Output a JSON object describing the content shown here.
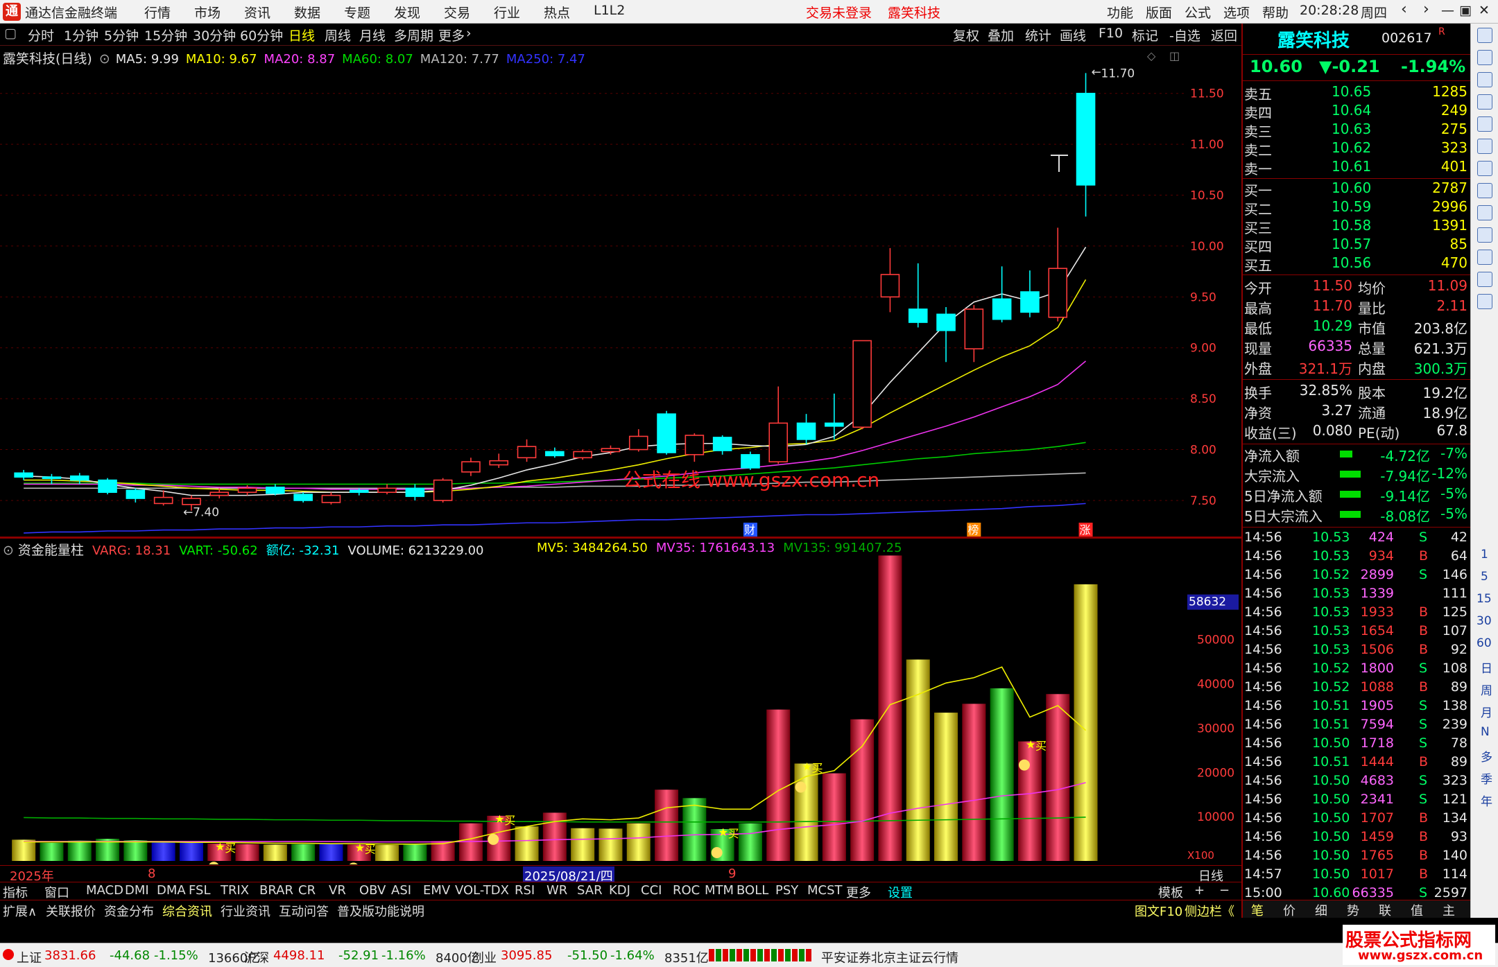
{
  "titlebar": {
    "app_name": "通达信金融终端",
    "menus": [
      "行情",
      "市场",
      "资讯",
      "数据",
      "专题",
      "发现",
      "交易",
      "行业",
      "热点",
      "L1L2"
    ],
    "trade_status": "交易未登录",
    "stock_name": "露笑科技",
    "right_menus": [
      "功能",
      "版面",
      "公式",
      "选项",
      "帮助"
    ],
    "time": "20:28:28",
    "weekday": "周四"
  },
  "periodbar": {
    "items": [
      "分时",
      "1分钟",
      "5分钟",
      "15分钟",
      "30分钟",
      "60分钟",
      "日线",
      "周线",
      "月线",
      "多周期",
      "更多"
    ],
    "selected": "日线",
    "right_items": [
      "复权",
      "叠加",
      "统计",
      "画线",
      "F10",
      "标记",
      "-自选",
      "返回"
    ]
  },
  "main_chart": {
    "legend_name": "露笑科技(日线)",
    "ma": [
      {
        "label": "MA5: 9.99",
        "color": "#e8e8e8"
      },
      {
        "label": "MA10: 9.67",
        "color": "#ffff00"
      },
      {
        "label": "MA20: 8.87",
        "color": "#ff44ff"
      },
      {
        "label": "MA60: 8.07",
        "color": "#00dd00"
      },
      {
        "label": "MA120: 7.77",
        "color": "#bbbbbb"
      },
      {
        "label": "MA250: 7.47",
        "color": "#3333ff"
      }
    ],
    "price_ticks": [
      "11.50",
      "11.00",
      "10.50",
      "10.00",
      "9.50",
      "9.00",
      "8.50",
      "8.00",
      "7.50"
    ],
    "high_label": "11.70",
    "low_label": "7.40",
    "watermark": "公式在线 www.gszx.com.cn",
    "event_markers": [
      "财",
      "榜",
      "涨"
    ]
  },
  "chart_data": {
    "type": "candlestick",
    "y_range": [
      7.2,
      11.9
    ],
    "candles": [
      {
        "o": 7.77,
        "c": 7.73,
        "h": 7.8,
        "l": 7.7
      },
      {
        "o": 7.73,
        "c": 7.72,
        "h": 7.76,
        "l": 7.66
      },
      {
        "o": 7.74,
        "c": 7.7,
        "h": 7.77,
        "l": 7.66
      },
      {
        "o": 7.7,
        "c": 7.58,
        "h": 7.72,
        "l": 7.56
      },
      {
        "o": 7.6,
        "c": 7.52,
        "h": 7.62,
        "l": 7.48
      },
      {
        "o": 7.47,
        "c": 7.53,
        "h": 7.6,
        "l": 7.45
      },
      {
        "o": 7.46,
        "c": 7.52,
        "h": 7.55,
        "l": 7.4
      },
      {
        "o": 7.55,
        "c": 7.58,
        "h": 7.62,
        "l": 7.52
      },
      {
        "o": 7.58,
        "c": 7.62,
        "h": 7.65,
        "l": 7.55
      },
      {
        "o": 7.63,
        "c": 7.57,
        "h": 7.66,
        "l": 7.55
      },
      {
        "o": 7.56,
        "c": 7.5,
        "h": 7.58,
        "l": 7.48
      },
      {
        "o": 7.48,
        "c": 7.55,
        "h": 7.58,
        "l": 7.46
      },
      {
        "o": 7.6,
        "c": 7.58,
        "h": 7.62,
        "l": 7.55
      },
      {
        "o": 7.58,
        "c": 7.62,
        "h": 7.66,
        "l": 7.56
      },
      {
        "o": 7.62,
        "c": 7.54,
        "h": 7.66,
        "l": 7.5
      },
      {
        "o": 7.5,
        "c": 7.7,
        "h": 7.72,
        "l": 7.48
      },
      {
        "o": 7.78,
        "c": 7.88,
        "h": 7.92,
        "l": 7.74
      },
      {
        "o": 7.85,
        "c": 7.89,
        "h": 7.96,
        "l": 7.82
      },
      {
        "o": 7.92,
        "c": 8.03,
        "h": 8.1,
        "l": 7.88
      },
      {
        "o": 7.98,
        "c": 7.94,
        "h": 8.02,
        "l": 7.92
      },
      {
        "o": 7.92,
        "c": 7.98,
        "h": 8.0,
        "l": 7.9
      },
      {
        "o": 7.98,
        "c": 8.01,
        "h": 8.04,
        "l": 7.95
      },
      {
        "o": 8.0,
        "c": 8.13,
        "h": 8.2,
        "l": 7.98
      },
      {
        "o": 8.35,
        "c": 7.97,
        "h": 8.38,
        "l": 7.95
      },
      {
        "o": 7.95,
        "c": 8.14,
        "h": 8.16,
        "l": 7.88
      },
      {
        "o": 8.12,
        "c": 7.99,
        "h": 8.14,
        "l": 7.95
      },
      {
        "o": 7.95,
        "c": 7.82,
        "h": 7.98,
        "l": 7.8
      },
      {
        "o": 7.88,
        "c": 8.26,
        "h": 8.62,
        "l": 7.86
      },
      {
        "o": 8.26,
        "c": 8.1,
        "h": 8.35,
        "l": 8.05
      },
      {
        "o": 8.26,
        "c": 8.23,
        "h": 8.55,
        "l": 8.1
      },
      {
        "o": 8.22,
        "c": 9.07,
        "h": 9.07,
        "l": 8.2
      },
      {
        "o": 9.5,
        "c": 9.72,
        "h": 9.98,
        "l": 9.35
      },
      {
        "o": 9.38,
        "c": 9.25,
        "h": 9.83,
        "l": 9.2
      },
      {
        "o": 9.33,
        "c": 9.17,
        "h": 9.4,
        "l": 8.86
      },
      {
        "o": 8.99,
        "c": 9.38,
        "h": 9.42,
        "l": 8.86
      },
      {
        "o": 9.48,
        "c": 9.28,
        "h": 9.8,
        "l": 9.25
      },
      {
        "o": 9.55,
        "c": 9.35,
        "h": 9.76,
        "l": 9.3
      },
      {
        "o": 9.3,
        "c": 9.78,
        "h": 10.18,
        "l": 9.26
      },
      {
        "o": 11.5,
        "c": 10.6,
        "h": 11.7,
        "l": 10.29
      }
    ],
    "ma5": [
      7.74,
      7.73,
      7.71,
      7.66,
      7.62,
      7.59,
      7.55,
      7.55,
      7.55,
      7.56,
      7.58,
      7.58,
      7.58,
      7.58,
      7.58,
      7.6,
      7.65,
      7.72,
      7.8,
      7.86,
      7.93,
      7.97,
      8.03,
      8.05,
      8.06,
      8.06,
      8.04,
      8.03,
      8.05,
      8.13,
      8.34,
      8.66,
      8.95,
      9.24,
      9.45,
      9.53,
      9.46,
      9.55,
      9.99
    ],
    "ma10": [
      7.7,
      7.7,
      7.69,
      7.68,
      7.66,
      7.64,
      7.62,
      7.61,
      7.6,
      7.6,
      7.59,
      7.58,
      7.58,
      7.58,
      7.58,
      7.59,
      7.61,
      7.64,
      7.69,
      7.72,
      7.76,
      7.8,
      7.85,
      7.91,
      7.96,
      8.0,
      8.02,
      8.05,
      8.06,
      8.09,
      8.21,
      8.36,
      8.5,
      8.64,
      8.78,
      8.91,
      9.02,
      9.2,
      9.67
    ],
    "ma20": [
      7.66,
      7.66,
      7.66,
      7.66,
      7.65,
      7.65,
      7.64,
      7.63,
      7.63,
      7.62,
      7.62,
      7.61,
      7.61,
      7.61,
      7.61,
      7.61,
      7.62,
      7.63,
      7.64,
      7.66,
      7.68,
      7.7,
      7.72,
      7.74,
      7.77,
      7.8,
      7.82,
      7.85,
      7.88,
      7.92,
      7.99,
      8.07,
      8.15,
      8.23,
      8.32,
      8.42,
      8.52,
      8.64,
      8.87
    ],
    "ma60": [
      7.67,
      7.67,
      7.67,
      7.67,
      7.67,
      7.66,
      7.66,
      7.66,
      7.66,
      7.66,
      7.66,
      7.66,
      7.66,
      7.66,
      7.66,
      7.66,
      7.67,
      7.67,
      7.68,
      7.68,
      7.69,
      7.7,
      7.71,
      7.72,
      7.73,
      7.74,
      7.76,
      7.78,
      7.8,
      7.82,
      7.85,
      7.88,
      7.91,
      7.93,
      7.96,
      7.98,
      8.0,
      8.03,
      8.07
    ],
    "ma120": [
      7.62,
      7.62,
      7.62,
      7.62,
      7.62,
      7.62,
      7.62,
      7.62,
      7.62,
      7.62,
      7.62,
      7.62,
      7.62,
      7.62,
      7.62,
      7.62,
      7.62,
      7.63,
      7.63,
      7.63,
      7.64,
      7.64,
      7.64,
      7.65,
      7.65,
      7.66,
      7.66,
      7.67,
      7.68,
      7.68,
      7.69,
      7.7,
      7.71,
      7.72,
      7.73,
      7.74,
      7.75,
      7.76,
      7.77
    ],
    "ma250": [
      7.18,
      7.19,
      7.19,
      7.2,
      7.2,
      7.21,
      7.21,
      7.22,
      7.22,
      7.23,
      7.23,
      7.24,
      7.24,
      7.25,
      7.25,
      7.26,
      7.26,
      7.27,
      7.28,
      7.28,
      7.29,
      7.3,
      7.31,
      7.31,
      7.32,
      7.33,
      7.34,
      7.35,
      7.36,
      7.36,
      7.37,
      7.38,
      7.39,
      7.4,
      7.41,
      7.42,
      7.44,
      7.45,
      7.47
    ]
  },
  "indicator": {
    "name": "资金能量柱",
    "fields": [
      {
        "label": "VARG: 18.31",
        "color": "#ff4444"
      },
      {
        "label": "VART: -50.62",
        "color": "#00ee00"
      },
      {
        "label": "额亿: -32.31",
        "color": "#00ffff"
      },
      {
        "label": "VOLUME: 6213229.00",
        "color": "#e8e8e8"
      }
    ],
    "mv_fields": [
      {
        "label": "MV5: 3484264.50",
        "color": "#ffff00"
      },
      {
        "label": "MV35: 1761643.13",
        "color": "#ff44ff"
      },
      {
        "label": "MV135: 991407.25",
        "color": "#00aa00"
      }
    ],
    "ticks": [
      "50000",
      "40000",
      "30000",
      "20000",
      "10000"
    ],
    "highlight_tick": "58632",
    "scale_label": "X100",
    "buy_label": "买",
    "bars": [
      4800,
      4100,
      4600,
      5000,
      4700,
      4300,
      4200,
      3900,
      3800,
      3700,
      3800,
      3900,
      3700,
      3600,
      3800,
      4500,
      8500,
      10200,
      7800,
      10900,
      7400,
      7300,
      8500,
      16100,
      14200,
      7200,
      8500,
      34200,
      22000,
      19800,
      32000,
      69000,
      45500,
      33500,
      35500,
      39000,
      27000,
      37700,
      62500
    ],
    "colors": [
      "y",
      "g",
      "g",
      "g",
      "g",
      "b",
      "b",
      "r",
      "r",
      "y",
      "g",
      "b",
      "r",
      "y",
      "g",
      "r",
      "r",
      "r",
      "y",
      "r",
      "y",
      "y",
      "y",
      "r",
      "g",
      "g",
      "g",
      "r",
      "y",
      "r",
      "r",
      "r",
      "y",
      "y",
      "r",
      "g",
      "r",
      "r",
      "y"
    ],
    "mv5": [
      4300,
      4300,
      4300,
      4300,
      4300,
      4300,
      4200,
      4200,
      4100,
      4000,
      4000,
      3900,
      3900,
      3800,
      3800,
      3900,
      5000,
      6500,
      7800,
      8900,
      9500,
      9300,
      9700,
      12000,
      12600,
      11700,
      11700,
      15900,
      19100,
      20400,
      25900,
      35300,
      37600,
      40200,
      41400,
      43800,
      32500,
      35100,
      29500,
      34000
    ],
    "mv35": [
      4400,
      4400,
      4400,
      4400,
      4400,
      4400,
      4400,
      4400,
      4400,
      4400,
      4400,
      4400,
      4300,
      4300,
      4300,
      4300,
      4400,
      4500,
      4600,
      4800,
      4900,
      5000,
      5200,
      5600,
      5900,
      6000,
      6200,
      7100,
      7700,
      8200,
      9000,
      10800,
      11900,
      12800,
      13700,
      14700,
      15200,
      16100,
      17700
    ],
    "mv135": [
      9800,
      9700,
      9700,
      9600,
      9600,
      9500,
      9500,
      9400,
      9400,
      9300,
      9300,
      9200,
      9200,
      9100,
      9100,
      9000,
      9000,
      8900,
      8900,
      8900,
      8800,
      8800,
      8800,
      8800,
      8800,
      8800,
      8800,
      8800,
      8900,
      8900,
      9000,
      9100,
      9200,
      9300,
      9400,
      9500,
      9600,
      9700,
      9900
    ],
    "buy_points": [
      7,
      12,
      17,
      25,
      28,
      36
    ]
  },
  "date_axis": {
    "labels": [
      "2025年",
      "8",
      "2025/08/21/四",
      "9"
    ],
    "mode": "日线"
  },
  "tabs_row1": [
    "指标",
    "窗口",
    "MACD",
    "DMI",
    "DMA",
    "FSL",
    "TRIX",
    "BRAR",
    "CR",
    "VR",
    "OBV",
    "ASI",
    "EMV",
    "VOL-TDX",
    "RSI",
    "WR",
    "SAR",
    "KDJ",
    "CCI",
    "ROC",
    "MTM",
    "BOLL",
    "PSY",
    "MCST",
    "更多",
    "设置"
  ],
  "tabs_row1_right": "模板",
  "tabs_row2": [
    "扩展∧",
    "关联报价",
    "资金分布",
    "综合资讯",
    "行业资讯",
    "互动问答",
    "普及版功能说明"
  ],
  "tabs_row2_right": [
    "图文F10",
    "侧边栏《"
  ],
  "side": {
    "name": "露笑科技",
    "code": "002617",
    "flag": "R",
    "price": "10.60",
    "change": "▼-0.21",
    "pct": "-1.94%",
    "asks": [
      {
        "label": "卖五",
        "price": "10.65",
        "vol": "1285"
      },
      {
        "label": "卖四",
        "price": "10.64",
        "vol": "249"
      },
      {
        "label": "卖三",
        "price": "10.63",
        "vol": "275"
      },
      {
        "label": "卖二",
        "price": "10.62",
        "vol": "323"
      },
      {
        "label": "卖一",
        "price": "10.61",
        "vol": "401"
      }
    ],
    "bids": [
      {
        "label": "买一",
        "price": "10.60",
        "vol": "2787"
      },
      {
        "label": "买二",
        "price": "10.59",
        "vol": "2996"
      },
      {
        "label": "买三",
        "price": "10.58",
        "vol": "1391"
      },
      {
        "label": "买四",
        "price": "10.57",
        "vol": "85"
      },
      {
        "label": "买五",
        "price": "10.56",
        "vol": "470"
      }
    ],
    "stats": [
      {
        "l1": "今开",
        "v1": "11.50",
        "c1": "r",
        "l2": "均价",
        "v2": "11.09",
        "c2": "r"
      },
      {
        "l1": "最高",
        "v1": "11.70",
        "c1": "r",
        "l2": "量比",
        "v2": "2.11",
        "c2": "r"
      },
      {
        "l1": "最低",
        "v1": "10.29",
        "c1": "g",
        "l2": "市值",
        "v2": "203.8亿",
        "c2": "w"
      },
      {
        "l1": "现量",
        "v1": "66335",
        "c1": "m",
        "l2": "总量",
        "v2": "621.3万",
        "c2": "w"
      },
      {
        "l1": "外盘",
        "v1": "321.1万",
        "c1": "r",
        "l2": "内盘",
        "v2": "300.3万",
        "c2": "g"
      }
    ],
    "stats2": [
      {
        "l1": "换手",
        "v1": "32.85%",
        "l2": "股本",
        "v2": "19.2亿"
      },
      {
        "l1": "净资",
        "v1": "3.27",
        "l2": "流通",
        "v2": "18.9亿"
      },
      {
        "l1": "收益(三)",
        "v1": "0.080",
        "l2": "PE(动)",
        "v2": "67.8"
      }
    ],
    "flows": [
      {
        "label": "净流入额",
        "value": "-4.72亿",
        "pct": "-7%"
      },
      {
        "label": "大宗流入",
        "value": "-7.94亿",
        "pct": "-12%"
      },
      {
        "label": "5日净流入额",
        "value": "-9.14亿",
        "pct": "-5%"
      },
      {
        "label": "5日大宗流入",
        "value": "-8.08亿",
        "pct": "-5%"
      }
    ],
    "ticks": [
      {
        "t": "14:56",
        "p": "10.53",
        "v": "424",
        "s": "S",
        "n": "42"
      },
      {
        "t": "14:56",
        "p": "10.53",
        "v": "934",
        "s": "B",
        "n": "64"
      },
      {
        "t": "14:56",
        "p": "10.52",
        "v": "2899",
        "s": "S",
        "n": "146"
      },
      {
        "t": "14:56",
        "p": "10.53",
        "v": "1339",
        "s": "",
        "n": "111"
      },
      {
        "t": "14:56",
        "p": "10.53",
        "v": "1933",
        "s": "B",
        "n": "125"
      },
      {
        "t": "14:56",
        "p": "10.53",
        "v": "1654",
        "s": "B",
        "n": "107"
      },
      {
        "t": "14:56",
        "p": "10.53",
        "v": "1506",
        "s": "B",
        "n": "92"
      },
      {
        "t": "14:56",
        "p": "10.52",
        "v": "1800",
        "s": "S",
        "n": "108"
      },
      {
        "t": "14:56",
        "p": "10.52",
        "v": "1088",
        "s": "B",
        "n": "89"
      },
      {
        "t": "14:56",
        "p": "10.51",
        "v": "1905",
        "s": "S",
        "n": "138"
      },
      {
        "t": "14:56",
        "p": "10.51",
        "v": "7594",
        "s": "S",
        "n": "239"
      },
      {
        "t": "14:56",
        "p": "10.50",
        "v": "1718",
        "s": "S",
        "n": "78"
      },
      {
        "t": "14:56",
        "p": "10.51",
        "v": "1444",
        "s": "B",
        "n": "89"
      },
      {
        "t": "14:56",
        "p": "10.50",
        "v": "4683",
        "s": "S",
        "n": "323"
      },
      {
        "t": "14:56",
        "p": "10.50",
        "v": "2341",
        "s": "S",
        "n": "121"
      },
      {
        "t": "14:56",
        "p": "10.50",
        "v": "1707",
        "s": "B",
        "n": "134"
      },
      {
        "t": "14:56",
        "p": "10.50",
        "v": "1459",
        "s": "B",
        "n": "93"
      },
      {
        "t": "14:56",
        "p": "10.50",
        "v": "1765",
        "s": "B",
        "n": "140"
      },
      {
        "t": "14:57",
        "p": "10.50",
        "v": "1017",
        "s": "B",
        "n": "114"
      },
      {
        "t": "15:00",
        "p": "10.60",
        "v": "66335",
        "s": "S",
        "n": "2597"
      }
    ],
    "bottom_tabs": [
      "笔",
      "价",
      "细",
      "势",
      "联",
      "值",
      "主"
    ]
  },
  "iconstrip": {
    "text_items": [
      "1",
      "5",
      "15",
      "30",
      "60",
      "日",
      "周",
      "月",
      "N",
      "多",
      "季",
      "年"
    ]
  },
  "statusbar": {
    "items": [
      {
        "name": "上证",
        "val": "3831.66",
        "chg": "-44.68",
        "pct": "-1.15%",
        "amt": "13660亿"
      },
      {
        "name": "沪深",
        "val": "4498.11",
        "chg": "-52.91",
        "pct": "-1.16%",
        "amt": "8400亿"
      },
      {
        "name": "创业",
        "val": "3095.85",
        "chg": "-51.50",
        "pct": "-1.64%",
        "amt": "8351亿"
      }
    ],
    "broker": "平安证券北京主证云行情",
    "watermark_title": "股票公式指标网",
    "watermark_url": "www.gszx.com.cn"
  }
}
